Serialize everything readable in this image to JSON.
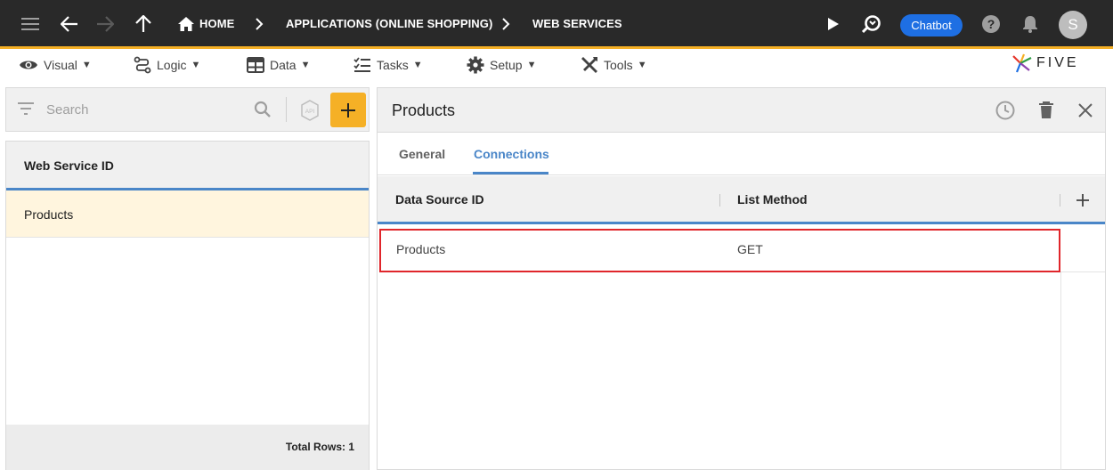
{
  "topbar": {
    "breadcrumbs": [
      "HOME",
      "APPLICATIONS (ONLINE SHOPPING)",
      "WEB SERVICES"
    ],
    "chatbot_label": "Chatbot",
    "avatar_initial": "S",
    "accent_color": "#f5b026"
  },
  "menu": {
    "items": [
      "Visual",
      "Logic",
      "Data",
      "Tasks",
      "Setup",
      "Tools"
    ],
    "logo_text": "FIVE"
  },
  "left_panel": {
    "search_placeholder": "Search",
    "column_header": "Web Service ID",
    "rows": [
      "Products"
    ],
    "total_rows": "Total Rows: 1"
  },
  "right_panel": {
    "title": "Products",
    "tabs": [
      "General",
      "Connections"
    ],
    "active_tab": "Connections",
    "columns": [
      "Data Source ID",
      "List Method"
    ],
    "rows": [
      {
        "data_source_id": "Products",
        "list_method": "GET"
      }
    ]
  },
  "colors": {
    "topbar_bg": "#292929",
    "chatbot_bg": "#1e6fe3",
    "active_tab": "#4a86c8",
    "selected_row_bg": "#fff5de",
    "highlight_border": "#e0262b"
  }
}
